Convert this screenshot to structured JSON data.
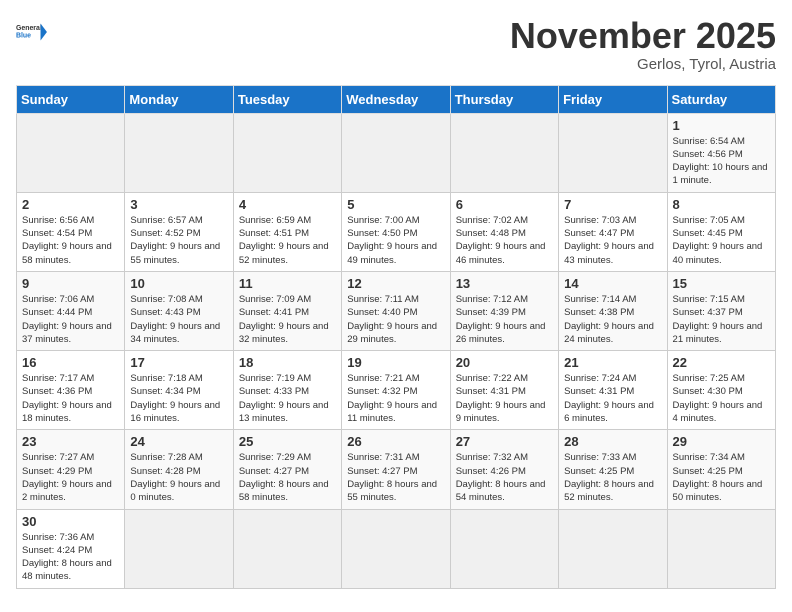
{
  "header": {
    "logo_general": "General",
    "logo_blue": "Blue",
    "month_title": "November 2025",
    "subtitle": "Gerlos, Tyrol, Austria"
  },
  "weekdays": [
    "Sunday",
    "Monday",
    "Tuesday",
    "Wednesday",
    "Thursday",
    "Friday",
    "Saturday"
  ],
  "weeks": [
    [
      {
        "day": "",
        "info": ""
      },
      {
        "day": "",
        "info": ""
      },
      {
        "day": "",
        "info": ""
      },
      {
        "day": "",
        "info": ""
      },
      {
        "day": "",
        "info": ""
      },
      {
        "day": "",
        "info": ""
      },
      {
        "day": "1",
        "info": "Sunrise: 6:54 AM\nSunset: 4:56 PM\nDaylight: 10 hours and 1 minute."
      }
    ],
    [
      {
        "day": "2",
        "info": "Sunrise: 6:56 AM\nSunset: 4:54 PM\nDaylight: 9 hours and 58 minutes."
      },
      {
        "day": "3",
        "info": "Sunrise: 6:57 AM\nSunset: 4:52 PM\nDaylight: 9 hours and 55 minutes."
      },
      {
        "day": "4",
        "info": "Sunrise: 6:59 AM\nSunset: 4:51 PM\nDaylight: 9 hours and 52 minutes."
      },
      {
        "day": "5",
        "info": "Sunrise: 7:00 AM\nSunset: 4:50 PM\nDaylight: 9 hours and 49 minutes."
      },
      {
        "day": "6",
        "info": "Sunrise: 7:02 AM\nSunset: 4:48 PM\nDaylight: 9 hours and 46 minutes."
      },
      {
        "day": "7",
        "info": "Sunrise: 7:03 AM\nSunset: 4:47 PM\nDaylight: 9 hours and 43 minutes."
      },
      {
        "day": "8",
        "info": "Sunrise: 7:05 AM\nSunset: 4:45 PM\nDaylight: 9 hours and 40 minutes."
      }
    ],
    [
      {
        "day": "9",
        "info": "Sunrise: 7:06 AM\nSunset: 4:44 PM\nDaylight: 9 hours and 37 minutes."
      },
      {
        "day": "10",
        "info": "Sunrise: 7:08 AM\nSunset: 4:43 PM\nDaylight: 9 hours and 34 minutes."
      },
      {
        "day": "11",
        "info": "Sunrise: 7:09 AM\nSunset: 4:41 PM\nDaylight: 9 hours and 32 minutes."
      },
      {
        "day": "12",
        "info": "Sunrise: 7:11 AM\nSunset: 4:40 PM\nDaylight: 9 hours and 29 minutes."
      },
      {
        "day": "13",
        "info": "Sunrise: 7:12 AM\nSunset: 4:39 PM\nDaylight: 9 hours and 26 minutes."
      },
      {
        "day": "14",
        "info": "Sunrise: 7:14 AM\nSunset: 4:38 PM\nDaylight: 9 hours and 24 minutes."
      },
      {
        "day": "15",
        "info": "Sunrise: 7:15 AM\nSunset: 4:37 PM\nDaylight: 9 hours and 21 minutes."
      }
    ],
    [
      {
        "day": "16",
        "info": "Sunrise: 7:17 AM\nSunset: 4:36 PM\nDaylight: 9 hours and 18 minutes."
      },
      {
        "day": "17",
        "info": "Sunrise: 7:18 AM\nSunset: 4:34 PM\nDaylight: 9 hours and 16 minutes."
      },
      {
        "day": "18",
        "info": "Sunrise: 7:19 AM\nSunset: 4:33 PM\nDaylight: 9 hours and 13 minutes."
      },
      {
        "day": "19",
        "info": "Sunrise: 7:21 AM\nSunset: 4:32 PM\nDaylight: 9 hours and 11 minutes."
      },
      {
        "day": "20",
        "info": "Sunrise: 7:22 AM\nSunset: 4:31 PM\nDaylight: 9 hours and 9 minutes."
      },
      {
        "day": "21",
        "info": "Sunrise: 7:24 AM\nSunset: 4:31 PM\nDaylight: 9 hours and 6 minutes."
      },
      {
        "day": "22",
        "info": "Sunrise: 7:25 AM\nSunset: 4:30 PM\nDaylight: 9 hours and 4 minutes."
      }
    ],
    [
      {
        "day": "23",
        "info": "Sunrise: 7:27 AM\nSunset: 4:29 PM\nDaylight: 9 hours and 2 minutes."
      },
      {
        "day": "24",
        "info": "Sunrise: 7:28 AM\nSunset: 4:28 PM\nDaylight: 9 hours and 0 minutes."
      },
      {
        "day": "25",
        "info": "Sunrise: 7:29 AM\nSunset: 4:27 PM\nDaylight: 8 hours and 58 minutes."
      },
      {
        "day": "26",
        "info": "Sunrise: 7:31 AM\nSunset: 4:27 PM\nDaylight: 8 hours and 55 minutes."
      },
      {
        "day": "27",
        "info": "Sunrise: 7:32 AM\nSunset: 4:26 PM\nDaylight: 8 hours and 54 minutes."
      },
      {
        "day": "28",
        "info": "Sunrise: 7:33 AM\nSunset: 4:25 PM\nDaylight: 8 hours and 52 minutes."
      },
      {
        "day": "29",
        "info": "Sunrise: 7:34 AM\nSunset: 4:25 PM\nDaylight: 8 hours and 50 minutes."
      }
    ],
    [
      {
        "day": "30",
        "info": "Sunrise: 7:36 AM\nSunset: 4:24 PM\nDaylight: 8 hours and 48 minutes."
      },
      {
        "day": "",
        "info": ""
      },
      {
        "day": "",
        "info": ""
      },
      {
        "day": "",
        "info": ""
      },
      {
        "day": "",
        "info": ""
      },
      {
        "day": "",
        "info": ""
      },
      {
        "day": "",
        "info": ""
      }
    ]
  ]
}
